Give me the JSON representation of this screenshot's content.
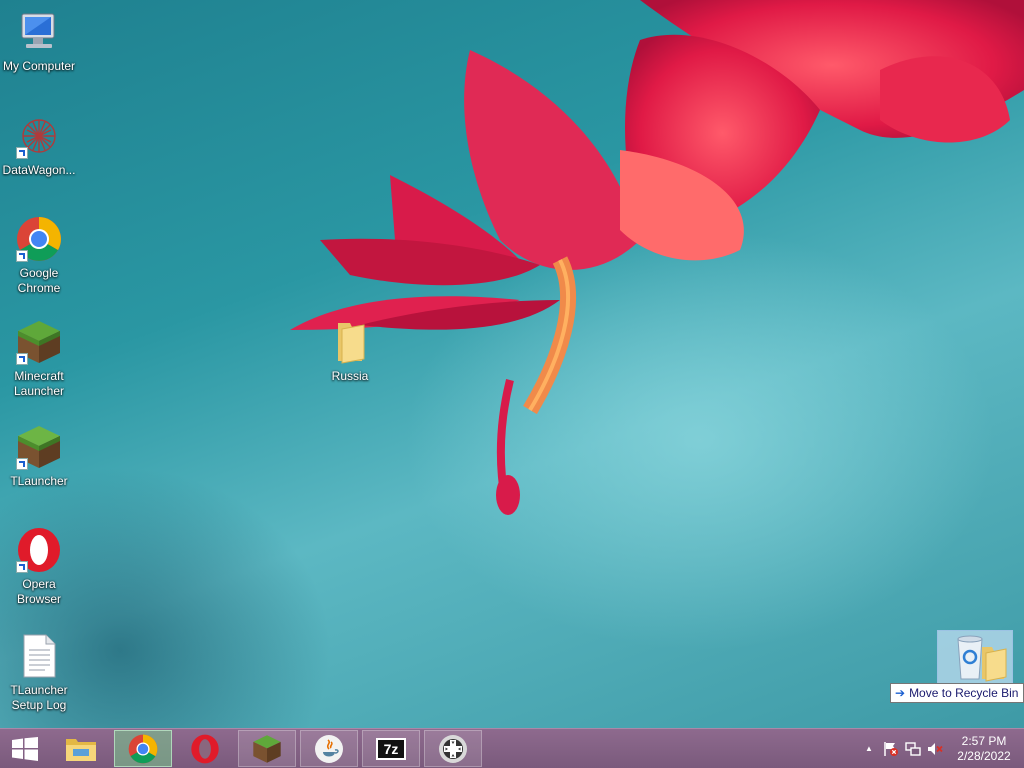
{
  "desktop": {
    "icons": [
      {
        "label": "My Computer",
        "icon": "my-computer-icon"
      },
      {
        "label": "DataWagon...",
        "icon": "datawagon-icon"
      },
      {
        "label": "Google Chrome",
        "icon": "chrome-icon"
      },
      {
        "label": "Minecraft Launcher",
        "icon": "minecraft-icon"
      },
      {
        "label": "TLauncher",
        "icon": "tlauncher-icon"
      },
      {
        "label": "Opera Browser",
        "icon": "opera-icon"
      },
      {
        "label": "TLauncher Setup Log",
        "icon": "text-file-icon"
      },
      {
        "label": "Russia",
        "icon": "folder-icon"
      }
    ],
    "drag_tooltip": "Move to Recycle Bin"
  },
  "taskbar": {
    "buttons": [
      {
        "name": "start-button",
        "icon": "windows-logo-icon"
      },
      {
        "name": "file-explorer",
        "icon": "file-explorer-icon"
      },
      {
        "name": "google-chrome",
        "icon": "chrome-icon"
      },
      {
        "name": "opera",
        "icon": "opera-icon"
      },
      {
        "name": "minecraft",
        "icon": "minecraft-icon"
      },
      {
        "name": "java",
        "icon": "java-icon"
      },
      {
        "name": "7-zip",
        "icon": "7zip-icon",
        "text": "7z"
      },
      {
        "name": "gamepad-app",
        "icon": "gamepad-icon"
      }
    ],
    "tray": {
      "overflow_arrow": "▲",
      "time": "2:57 PM",
      "date": "2/28/2022"
    }
  },
  "colors": {
    "taskbar": "#7a5a7c",
    "active_button": "#78c88c",
    "desktop_teal": "#2a97a3"
  }
}
